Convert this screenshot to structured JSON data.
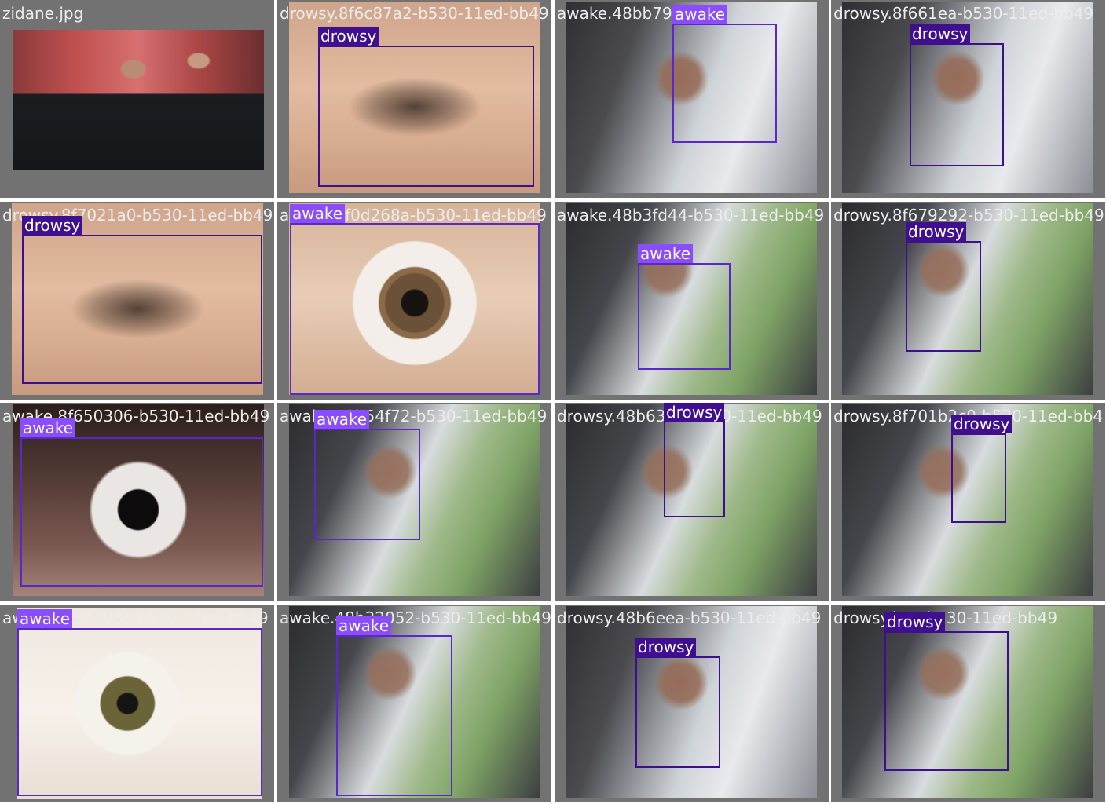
{
  "colors": {
    "tile_background": "#727272",
    "awake": "#8a4dff",
    "drowsy": "#3f0f8f",
    "caption_text": "#ececec"
  },
  "tiles": [
    {
      "caption": "zidane.jpg",
      "photo": "sport"
    },
    {
      "caption": "drowsy.8f6c87a2-b530-11ed-bb49",
      "photo": "eye",
      "detection": {
        "label": "drowsy"
      }
    },
    {
      "caption": "awake.48bb795",
      "photo": "car",
      "detection": {
        "label": "awake"
      }
    },
    {
      "caption": "drowsy.8f661ea-b530-11ed-bb49",
      "photo": "car",
      "detection": {
        "label": "drowsy"
      }
    },
    {
      "caption": "drowsy.8f7021a0-b530-11ed-bb49",
      "photo": "eye",
      "detection": {
        "label": "drowsy"
      }
    },
    {
      "caption": "awake.8f0d268a-b530-11ed-bb49",
      "photo": "eye-open",
      "detection": {
        "label": "awake"
      }
    },
    {
      "caption": "awake.48b3fd44-b530-11ed-bb49",
      "photo": "car-green",
      "detection": {
        "label": "awake"
      }
    },
    {
      "caption": "drowsy.8f679292-b530-11ed-bb49",
      "photo": "car-green",
      "detection": {
        "label": "drowsy"
      }
    },
    {
      "caption": "awake.8f650306-b530-11ed-bb49",
      "photo": "eye-dark",
      "detection": {
        "label": "awake"
      }
    },
    {
      "caption": "awake.48b54f72-b530-11ed-bb49",
      "photo": "car-green",
      "detection": {
        "label": "awake"
      }
    },
    {
      "caption": "drowsy.48b6359-b530-11ed-bb49",
      "photo": "car-green",
      "detection": {
        "label": "drowsy"
      }
    },
    {
      "caption": "drowsy.8f701b2c0-b530-11ed-bb4",
      "photo": "car-green",
      "detection": {
        "label": "drowsy"
      }
    },
    {
      "caption": "awake.8f54793c-b530-11ed-bb49",
      "photo": "eye-pale",
      "detection": {
        "label": "awake"
      }
    },
    {
      "caption": "awake.48b32052-b530-11ed-bb49",
      "photo": "car-green",
      "detection": {
        "label": "awake"
      }
    },
    {
      "caption": "drowsy.48b6eea-b530-11ed-bb49",
      "photo": "car",
      "detection": {
        "label": "drowsy"
      }
    },
    {
      "caption": "drowsy.b1c-b530-11ed-bb49",
      "photo": "car-green",
      "detection": {
        "label": "drowsy"
      }
    }
  ]
}
